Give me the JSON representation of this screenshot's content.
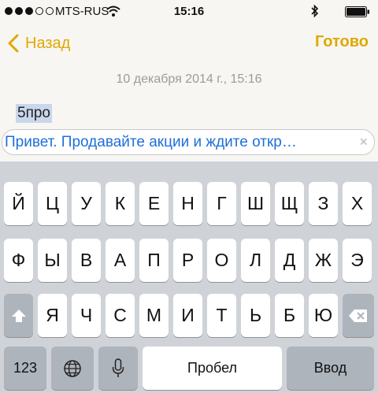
{
  "status_bar": {
    "carrier": "MTS-RUS",
    "time": "15:16"
  },
  "nav": {
    "back_label": "Назад",
    "done_label": "Готово"
  },
  "note": {
    "date": "10 декабря 2014 г., 15:16",
    "text": "5про"
  },
  "autocorrect": {
    "suggestion": "Привет. Продавайте акции и ждите откр…",
    "close_glyph": "×"
  },
  "keyboard": {
    "row1": [
      "Й",
      "Ц",
      "У",
      "К",
      "Е",
      "Н",
      "Г",
      "Ш",
      "Щ",
      "З",
      "Х"
    ],
    "row2": [
      "Ф",
      "Ы",
      "В",
      "А",
      "П",
      "Р",
      "О",
      "Л",
      "Д",
      "Ж",
      "Э"
    ],
    "row3": [
      "Я",
      "Ч",
      "С",
      "М",
      "И",
      "Т",
      "Ь",
      "Б",
      "Ю"
    ],
    "numbers_label": "123",
    "space_label": "Пробел",
    "return_label": "Ввод"
  },
  "colors": {
    "accent": "#e0a800",
    "link": "#1f6fd8",
    "selection": "#c9d7ec",
    "keyboard_bg": "#cfd3d8"
  }
}
